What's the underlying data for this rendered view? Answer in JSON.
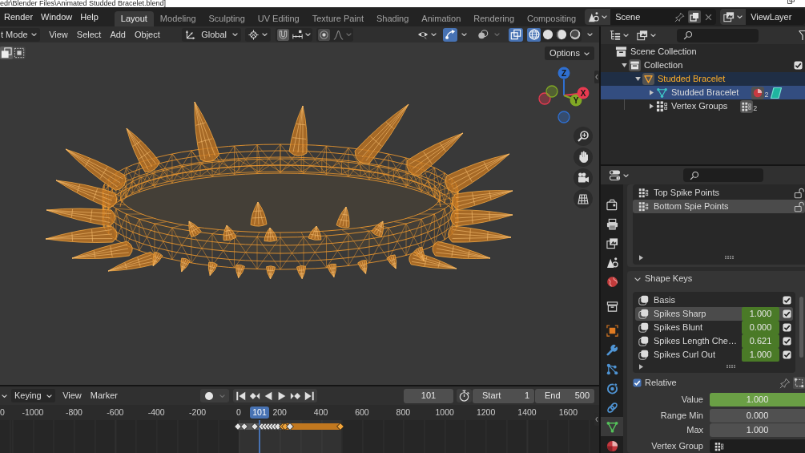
{
  "window": {
    "title": "edr\\Blender Files\\Animated Studded Bracelet.blend]"
  },
  "menus": [
    "Render",
    "Window",
    "Help"
  ],
  "workspaces": [
    {
      "label": "Layout",
      "selected": true
    },
    {
      "label": "Modeling",
      "selected": false
    },
    {
      "label": "Sculpting",
      "selected": false
    },
    {
      "label": "UV Editing",
      "selected": false
    },
    {
      "label": "Texture Paint",
      "selected": false
    },
    {
      "label": "Shading",
      "selected": false
    },
    {
      "label": "Animation",
      "selected": false
    },
    {
      "label": "Rendering",
      "selected": false
    },
    {
      "label": "Compositing",
      "selected": false
    }
  ],
  "scene": {
    "name": "Scene"
  },
  "view_layer": {
    "name": "ViewLayer"
  },
  "viewport": {
    "mode": "t Mode",
    "menus": [
      "View",
      "Select",
      "Add",
      "Object"
    ],
    "orientation": "Global",
    "toggles": [
      {
        "kind": "gizmos",
        "on": true
      },
      {
        "kind": "overlays",
        "on": false
      },
      {
        "kind": "xray",
        "on": true
      }
    ],
    "shading": [
      {
        "kind": "wireframe",
        "selected": true
      },
      {
        "kind": "solid",
        "selected": false
      },
      {
        "kind": "material",
        "selected": false
      },
      {
        "kind": "rendered",
        "selected": false
      }
    ],
    "select_modes": [
      {
        "kind": "set",
        "selected": true
      },
      {
        "kind": "extend",
        "selected": false
      }
    ],
    "options": "Options",
    "axes": [
      {
        "label": "Z",
        "color": "#2f6fd0"
      },
      {
        "label": "X",
        "color": "#e83a50"
      },
      {
        "label": "Y",
        "color": "#80a825"
      }
    ]
  },
  "timeline": {
    "menus": [
      {
        "kind": "dropdown",
        "label": "Keying"
      },
      {
        "kind": "menu",
        "label": "View"
      },
      {
        "kind": "menu",
        "label": "Marker"
      }
    ],
    "auto_keying": {
      "on": false
    },
    "frame": "101",
    "start": {
      "label": "Start",
      "value": "1"
    },
    "end": {
      "label": "End",
      "value": "500"
    },
    "ruler": [
      "0",
      "-1000",
      "-800",
      "-600",
      "-400",
      "-200",
      "0",
      "200",
      "400",
      "600",
      "800",
      "1000",
      "1200",
      "1400",
      "1600"
    ],
    "playhead": "101",
    "keyframes": [
      {
        "selected": false
      },
      {
        "selected": false
      },
      {
        "selected": false
      },
      {
        "selected": false
      },
      {
        "selected": false
      },
      {
        "selected": false
      },
      {
        "selected": false
      },
      {
        "selected": false
      },
      {
        "selected": false
      },
      {
        "selected": true
      },
      {
        "selected": true
      },
      {
        "selected": false
      },
      {
        "selected": true
      }
    ]
  },
  "outliner": {
    "tree": [
      {
        "label": "Scene Collection",
        "kind": "scene_collection",
        "active": false,
        "selected": false,
        "highlighted_icon": false,
        "children": [
          {
            "label": "Collection",
            "kind": "collection",
            "expanded": true,
            "checked": true,
            "active": false,
            "selected": false,
            "highlighted_icon": true,
            "children": [
              {
                "label": "Studded Bracelet",
                "kind": "object",
                "expanded": true,
                "active": true,
                "selected": false,
                "highlighted_icon": true,
                "children": [
                  {
                    "label": "Studded Bracelet",
                    "kind": "mesh",
                    "expanded": false,
                    "active": false,
                    "selected": true,
                    "highlighted_icon": false,
                    "extras": [
                      {
                        "kind": "materials",
                        "count": "2"
                      },
                      {
                        "kind": "shape_keys"
                      }
                    ]
                  },
                  {
                    "label": "Vertex Groups",
                    "kind": "vertex_groups",
                    "expanded": false,
                    "active": false,
                    "selected": false,
                    "highlighted_icon": false,
                    "extras": [
                      {
                        "kind": "vertex_groups",
                        "count": "2"
                      }
                    ]
                  }
                ]
              }
            ]
          }
        ]
      }
    ]
  },
  "properties": {
    "tabs": [
      {
        "kind": "render",
        "selected": false
      },
      {
        "kind": "output",
        "selected": false
      },
      {
        "kind": "view_layer",
        "selected": false
      },
      {
        "kind": "scene",
        "selected": false
      },
      {
        "kind": "world",
        "selected": false
      },
      {
        "kind": "collection",
        "selected": false
      },
      {
        "kind": "object",
        "selected": false
      },
      {
        "kind": "modifiers",
        "selected": false
      },
      {
        "kind": "particles",
        "selected": false
      },
      {
        "kind": "physics",
        "selected": false
      },
      {
        "kind": "constraints",
        "selected": false
      },
      {
        "kind": "data",
        "selected": true
      },
      {
        "kind": "material",
        "selected": false
      }
    ],
    "vertex_groups": [
      {
        "name": "Top Spike Points",
        "selected": false,
        "locked": false
      },
      {
        "name": "Bottom Spie Points",
        "selected": true,
        "locked": false
      }
    ],
    "shape_keys": {
      "title": "Shape Keys",
      "expanded": true,
      "keys": [
        {
          "name": "Basis",
          "selected": false,
          "checked": true
        },
        {
          "name": "Spikes Sharp",
          "value": "1.000",
          "selected": true,
          "checked": true
        },
        {
          "name": "Spikes Blunt",
          "value": "0.000",
          "selected": false,
          "checked": true
        },
        {
          "name": "Spikes Length Che…",
          "value": "0.621",
          "selected": false,
          "checked": true
        },
        {
          "name": "Spikes Curl Out",
          "value": "1.000",
          "selected": false,
          "checked": true
        }
      ],
      "relative": {
        "label": "Relative",
        "checked": true
      },
      "fields": [
        {
          "kind": "slider",
          "label": "Value",
          "value": "1.000",
          "level": 1
        },
        {
          "kind": "number",
          "label": "Range Min",
          "value": "0.000"
        },
        {
          "kind": "number",
          "label": "Max",
          "value": "1.000"
        },
        {
          "kind": "search",
          "label": "Vertex Group"
        }
      ]
    }
  }
}
